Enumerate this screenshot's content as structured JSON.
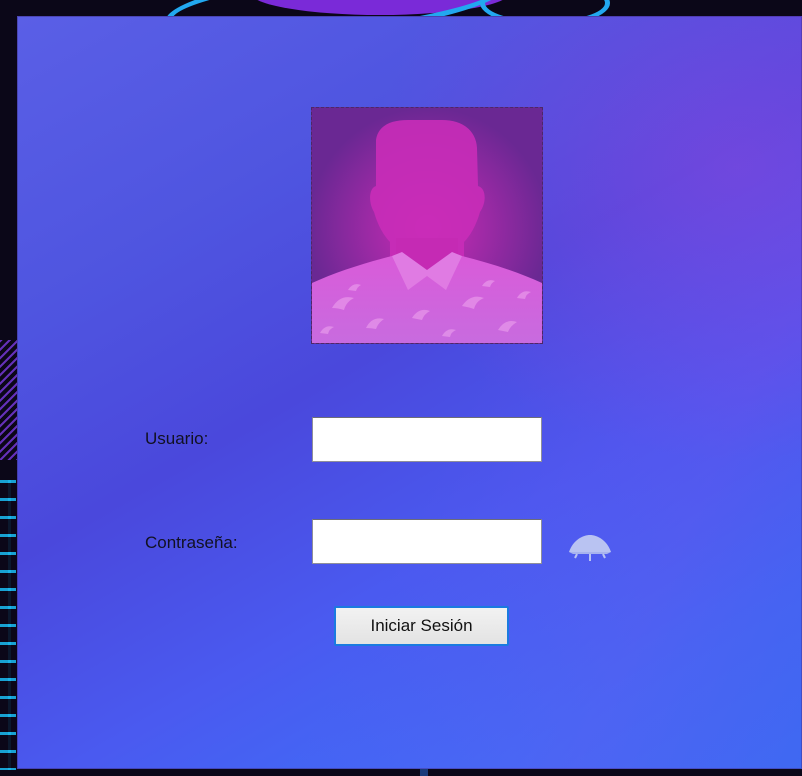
{
  "form": {
    "user_label": "Usuario:",
    "user_value": "",
    "password_label": "Contraseña:",
    "password_value": "",
    "login_button_label": "Iniciar Sesión"
  },
  "icons": {
    "avatar": "person-silhouette-icon",
    "password_toggle": "eye-icon"
  },
  "colors": {
    "form_gradient_start": "#5a5fe6",
    "form_gradient_end": "#3d74f8",
    "avatar_glow": "#d02ab5",
    "button_border": "#1a7be0",
    "eye_icon": "#b9c3f2"
  }
}
